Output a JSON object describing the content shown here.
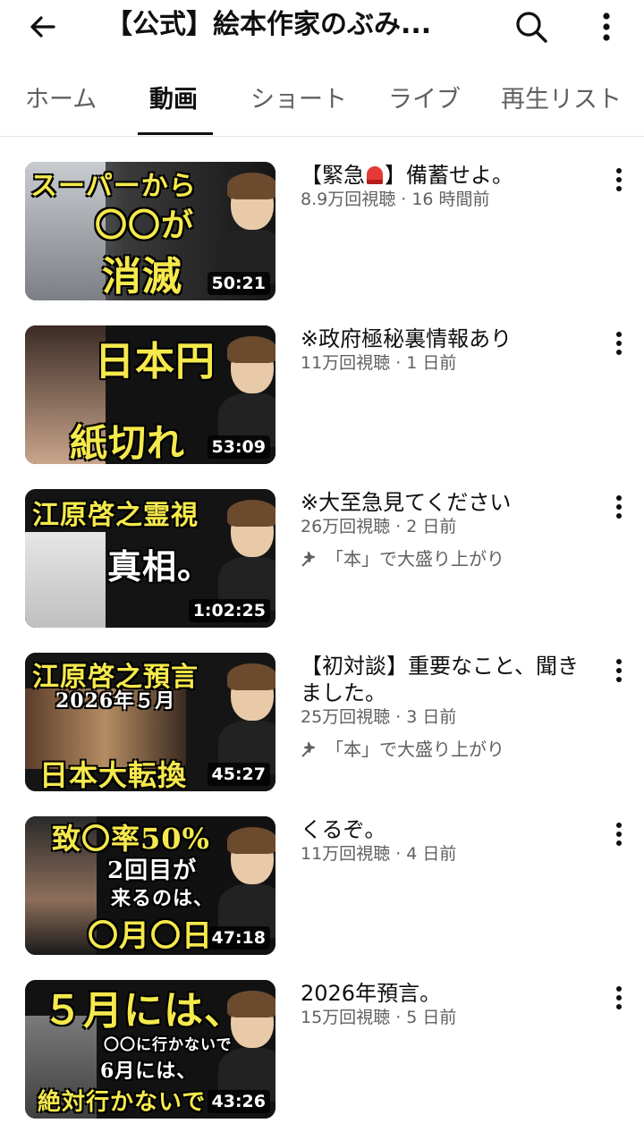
{
  "header": {
    "channel_title": "【公式】絵本作家のぶみ...",
    "back_icon": "arrow-left-icon",
    "search_icon": "search-icon",
    "more_icon": "vertical-dots-icon"
  },
  "tabs": [
    {
      "label": "ホーム",
      "active": false
    },
    {
      "label": "動画",
      "active": true
    },
    {
      "label": "ショート",
      "active": false
    },
    {
      "label": "ライブ",
      "active": false
    },
    {
      "label": "再生リスト",
      "active": false
    }
  ],
  "videos": [
    {
      "title_before": "【緊急",
      "title_after": "】備蓄せよ。",
      "title_icon": "siren-icon",
      "views": "8.9万回視聴",
      "age": "16 時間前",
      "stats": "8.9万回視聴 · 16 時間前",
      "duration": "50:21",
      "thumb_lines": [
        "スーパーから",
        "〇〇が",
        "消滅"
      ],
      "tag": ""
    },
    {
      "title": "※政府極秘裏情報あり",
      "stats": "11万回視聴 · 1 日前",
      "duration": "53:09",
      "thumb_lines": [
        "日本円",
        "紙切れ"
      ],
      "tag": ""
    },
    {
      "title": "※大至急見てください",
      "stats": "26万回視聴 · 2 日前",
      "duration": "1:02:25",
      "thumb_lines": [
        "江原啓之霊視",
        "真相。"
      ],
      "tag": "「本」で大盛り上がり"
    },
    {
      "title": "【初対談】重要なこと、聞きました。",
      "stats": "25万回視聴 · 3 日前",
      "duration": "45:27",
      "thumb_lines": [
        "江原啓之預言",
        "2026年５月",
        "日本大転換"
      ],
      "tag": "「本」で大盛り上がり"
    },
    {
      "title": "くるぞ。",
      "stats": "11万回視聴 · 4 日前",
      "duration": "47:18",
      "thumb_lines": [
        "致〇率50%",
        "2回目が",
        "来るのは、",
        "〇月〇日"
      ],
      "tag": ""
    },
    {
      "title": "2026年預言。",
      "stats": "15万回視聴 · 5 日前",
      "duration": "43:26",
      "thumb_lines": [
        "５月には、",
        "〇〇に行かないで",
        "6月には、",
        "絶対行かないで"
      ],
      "tag": ""
    }
  ],
  "colors": {
    "thumb_text": "#f5e94c",
    "secondary_text": "#606060",
    "primary_text": "#0f0f0f"
  }
}
